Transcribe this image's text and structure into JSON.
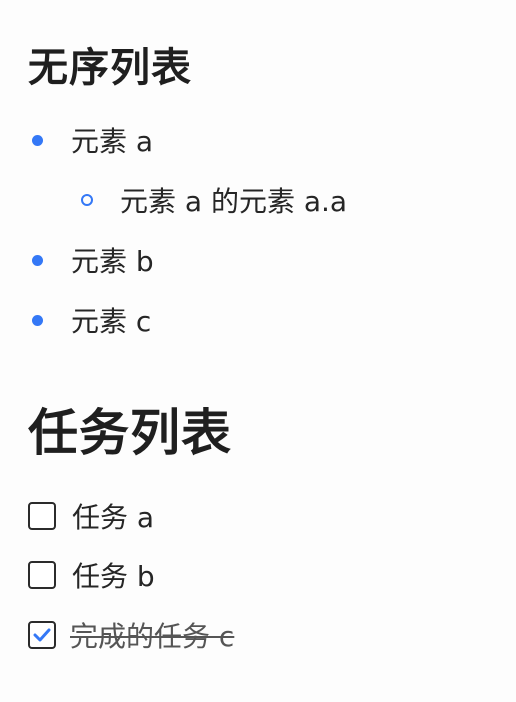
{
  "unordered_list": {
    "heading": "无序列表",
    "items": [
      {
        "label": "元素 a"
      },
      {
        "label": "元素 a 的元素 a.a"
      },
      {
        "label": "元素 b"
      },
      {
        "label": "元素 c"
      }
    ]
  },
  "task_list": {
    "heading": "任务列表",
    "items": [
      {
        "label": "任务 a",
        "checked": false
      },
      {
        "label": "任务 b",
        "checked": false
      },
      {
        "label": "完成的任务 c",
        "checked": true
      }
    ]
  },
  "colors": {
    "bullet_accent": "#3478f6",
    "checkmark": "#3478f6",
    "text": "#262626"
  },
  "icons": {
    "bullet": "filled-circle",
    "sub_bullet": "hollow-circle",
    "checkbox": "square-checkbox",
    "checkmark": "checkmark-icon"
  }
}
